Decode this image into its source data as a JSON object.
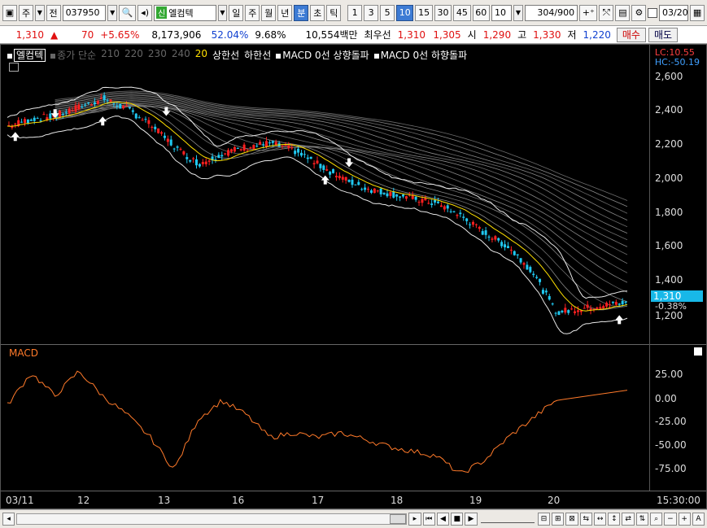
{
  "toolbar": {
    "period_type": "주",
    "prev_label": "전",
    "stock_code": "037950",
    "stock_name": "엘컴텍",
    "new_badge": "신",
    "period_buttons": [
      "일",
      "주",
      "월",
      "년",
      "분",
      "초",
      "틱"
    ],
    "active_period": "분",
    "minute_buttons": [
      "1",
      "3",
      "5",
      "10",
      "15",
      "30",
      "45",
      "60"
    ],
    "active_minute": "10",
    "count_select": "10",
    "view_count": "304",
    "view_total": "/900",
    "date_field": "03/20"
  },
  "quote": {
    "price": "1,310",
    "change": "70",
    "change_pct": "+5.65%",
    "volume": "8,173,906",
    "vol_ratio": "52.04%",
    "turnover": "9.68%",
    "amount": "10,554백만",
    "best_label": "최우선",
    "ask": "1,310",
    "bid": "1,305",
    "open_label": "시",
    "open": "1,290",
    "high_label": "고",
    "high": "1,330",
    "low_label": "저",
    "low": "1,220",
    "buy_label": "매수",
    "sell_label": "매도"
  },
  "legend": {
    "name": "엘컴텍",
    "ma_label": "종가 단순",
    "ma_periods": [
      "210",
      "220",
      "230",
      "240"
    ],
    "ma_hl": "20",
    "upper": "상한선",
    "lower": "하한선",
    "macd_up": "MACD 0선 상향돌파",
    "macd_down": "MACD 0선 하향돌파"
  },
  "stats": {
    "lc": "LC:10.55",
    "hc": "HC:-50.19"
  },
  "price_axis": {
    "labels": [
      "2,600",
      "2,400",
      "2,200",
      "2,000",
      "1,800",
      "1,600",
      "1,400",
      "1,200"
    ],
    "current": "1,310",
    "current_pct": "-0.38%"
  },
  "macd": {
    "title": "MACD",
    "labels": [
      "25.00",
      "0.00",
      "-25.00",
      "-50.00",
      "-75.00"
    ]
  },
  "date_axis": {
    "labels": [
      "03/11",
      "12",
      "13",
      "16",
      "17",
      "18",
      "19",
      "20"
    ],
    "time": "15:30:00"
  },
  "chart_data": {
    "type": "candlestick",
    "ylim": [
      1150,
      2650
    ],
    "macd_ylim": [
      -95,
      55
    ],
    "close_anchors": [
      [
        0,
        2320
      ],
      [
        15,
        2360
      ],
      [
        30,
        2380
      ],
      [
        45,
        2430
      ],
      [
        60,
        2480
      ],
      [
        75,
        2420
      ],
      [
        90,
        2330
      ],
      [
        105,
        2200
      ],
      [
        120,
        2100
      ],
      [
        135,
        2160
      ],
      [
        150,
        2200
      ],
      [
        165,
        2220
      ],
      [
        180,
        2180
      ],
      [
        195,
        2100
      ],
      [
        210,
        2020
      ],
      [
        225,
        1960
      ],
      [
        240,
        1930
      ],
      [
        255,
        1900
      ],
      [
        270,
        1870
      ],
      [
        285,
        1800
      ],
      [
        300,
        1700
      ],
      [
        315,
        1620
      ],
      [
        330,
        1480
      ],
      [
        345,
        1240
      ],
      [
        360,
        1260
      ],
      [
        375,
        1280
      ],
      [
        390,
        1300
      ]
    ],
    "macd_anchors": [
      [
        0,
        -5
      ],
      [
        15,
        30
      ],
      [
        30,
        5
      ],
      [
        45,
        32
      ],
      [
        60,
        5
      ],
      [
        75,
        -15
      ],
      [
        90,
        -40
      ],
      [
        105,
        -75
      ],
      [
        120,
        -20
      ],
      [
        135,
        0
      ],
      [
        150,
        -15
      ],
      [
        165,
        -40
      ],
      [
        180,
        -35
      ],
      [
        195,
        -40
      ],
      [
        210,
        -35
      ],
      [
        225,
        -42
      ],
      [
        240,
        -50
      ],
      [
        255,
        -55
      ],
      [
        270,
        -60
      ],
      [
        285,
        -80
      ],
      [
        300,
        -65
      ],
      [
        315,
        -40
      ],
      [
        330,
        -20
      ],
      [
        345,
        0
      ]
    ]
  }
}
